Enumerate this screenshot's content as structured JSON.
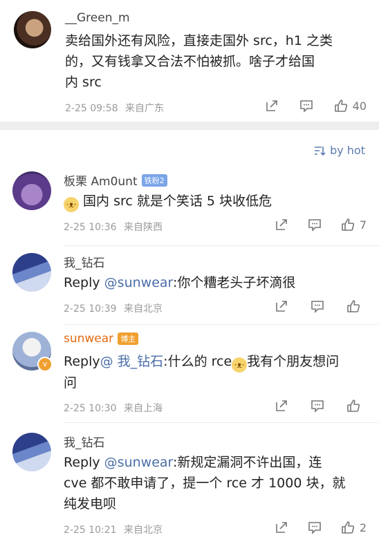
{
  "top": {
    "username": "__Green_m",
    "text_lines": [
      "卖给国外还有风险，直接走国外 src，h1 之类",
      "的，又有钱拿又合法不怕被抓。啥子才给国",
      "内 src"
    ],
    "date": "2-25 09:58",
    "location": "来自广东",
    "likes": "40"
  },
  "sort": {
    "label": "by hot",
    "icon": "sort-icon"
  },
  "comments": [
    {
      "username": "板栗 Am0unt",
      "badge": "铁粉2",
      "text_lines": [
        "国内 src 就是个笑话 5 块收低危"
      ],
      "date": "2-25 10:36",
      "location": "来自陕西",
      "likes": "7"
    },
    {
      "username": "我_钻石",
      "reply": "Reply ",
      "mention": "@sunwear",
      "text": ":你个糟老头子坏滴很",
      "date": "2-25 10:39",
      "location": "来自北京",
      "likes": ""
    },
    {
      "username": "sunwear",
      "badge": "博主",
      "reply": "Reply",
      "mention": "@ 我_钻石",
      "text1": ":什么的 rce",
      "text2": "我有个朋友想问",
      "text3": "问",
      "date": "2-25 10:30",
      "location": "来自上海",
      "likes": ""
    },
    {
      "username": "我_钻石",
      "reply": "Reply ",
      "mention": "@sunwear",
      "text1": ":新规定漏洞不许出国，连",
      "text2": "cve 都不敢申请了，提一个 rce 才 1000 块，就",
      "text3": "纯发电呗",
      "date": "2-25 10:21",
      "location": "来自北京",
      "likes": "2"
    }
  ]
}
